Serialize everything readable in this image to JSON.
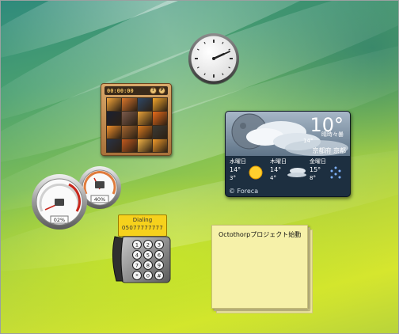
{
  "clock": {
    "hour": 2,
    "minute": 11
  },
  "puzzle": {
    "timer": "00:00:00",
    "buttons": [
      "?",
      "P"
    ],
    "tile_colors": [
      "#f3a43a",
      "#d9762c",
      "#2e4766",
      "#f0a42c",
      "#1b2031",
      "#7b5a4b",
      "#e8a238",
      "#e96b1a",
      "#ee8e2b",
      "#a46630",
      "#d97a1f",
      "#3b3a34",
      "#2a3346",
      "#c25a1f",
      "#f1b245",
      "#ef9a2b"
    ]
  },
  "weather": {
    "current_temp": "10°",
    "condition": "晴時々曇",
    "small_temp": "14°",
    "location": "京都府 京都",
    "forecast": [
      {
        "day": "水曜日",
        "high": "14°",
        "low": "3°",
        "icon": "sun-icon"
      },
      {
        "day": "木曜日",
        "high": "14°",
        "low": "4°",
        "icon": "cloudy-icon"
      },
      {
        "day": "金曜日",
        "high": "15°",
        "low": "8°",
        "icon": "snow-icon"
      }
    ],
    "credit": "© Foreca"
  },
  "cpu_meter": {
    "cpu_percent": "02%",
    "memory_percent": "40%"
  },
  "phone": {
    "status": "Dialing",
    "number": "05077777777",
    "keys": [
      "1",
      "2",
      "3",
      "4",
      "5",
      "6",
      "7",
      "8",
      "9",
      "*",
      "0",
      "#"
    ]
  },
  "note": {
    "text": "Octothorpプロジェクト始動"
  }
}
